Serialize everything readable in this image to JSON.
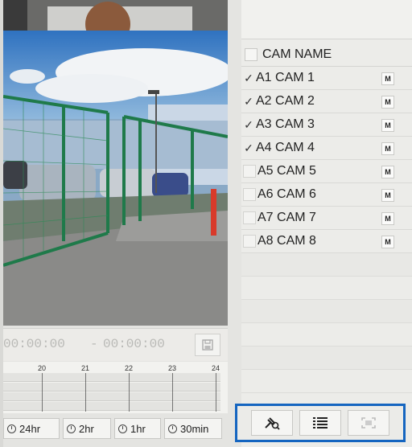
{
  "playback": {
    "start_time": "00:00:00",
    "separator": "-",
    "end_time": "00:00:00"
  },
  "timeline": {
    "hour_labels": [
      "20",
      "21",
      "22",
      "23",
      "24"
    ],
    "recorded_until_hour": 22
  },
  "durations": [
    {
      "label": "24hr"
    },
    {
      "label": "2hr"
    },
    {
      "label": "1hr"
    },
    {
      "label": "30min"
    }
  ],
  "camera_list": {
    "header": "CAM NAME",
    "cameras": [
      {
        "name": "A1 CAM 1",
        "checked": true,
        "badge": "M"
      },
      {
        "name": "A2 CAM 2",
        "checked": true,
        "badge": "M"
      },
      {
        "name": "A3 CAM 3",
        "checked": true,
        "badge": "M"
      },
      {
        "name": "A4 CAM 4",
        "checked": true,
        "badge": "M"
      },
      {
        "name": "A5 CAM 5",
        "checked": false,
        "badge": "M"
      },
      {
        "name": "A6 CAM 6",
        "checked": false,
        "badge": "M"
      },
      {
        "name": "A7 CAM 7",
        "checked": false,
        "badge": "M"
      },
      {
        "name": "A8 CAM 8",
        "checked": false,
        "badge": "M"
      }
    ]
  },
  "toolbar": {
    "icons": [
      "search-pin-icon",
      "list-icon",
      "fullscreen-icon"
    ]
  },
  "colors": {
    "accent": "#1565c0",
    "recording": "#27b037"
  }
}
